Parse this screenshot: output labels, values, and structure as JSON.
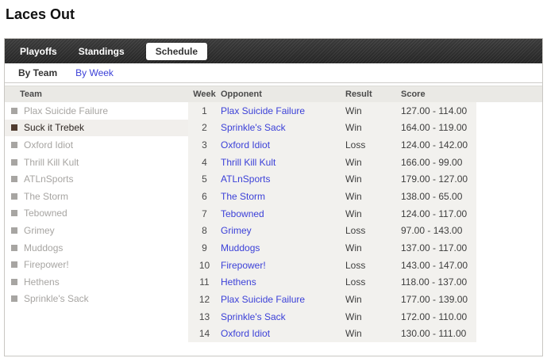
{
  "page": {
    "title": "Laces Out"
  },
  "colors": {
    "link_blue": "#3c41d8",
    "tabbar_dark": "#343434",
    "header_band": "#eae9e5",
    "table_block_bg": "#f2f1ee",
    "selected_bullet": "#503c30",
    "muted_team_text": "#a7a5a2"
  },
  "tabs": [
    {
      "label": "Playoffs",
      "active": false
    },
    {
      "label": "Standings",
      "active": false
    },
    {
      "label": "Schedule",
      "active": true
    }
  ],
  "subnav": [
    {
      "label": "By Team",
      "active": true
    },
    {
      "label": "By Week",
      "active": false
    }
  ],
  "sidebar": {
    "header": "Team",
    "teams": [
      {
        "name": "Plax Suicide Failure",
        "selected": false
      },
      {
        "name": "Suck it Trebek",
        "selected": true
      },
      {
        "name": "Oxford Idiot",
        "selected": false
      },
      {
        "name": "Thrill Kill Kult",
        "selected": false
      },
      {
        "name": "ATLnSports",
        "selected": false
      },
      {
        "name": "The Storm",
        "selected": false
      },
      {
        "name": "Tebowned",
        "selected": false
      },
      {
        "name": "Grimey",
        "selected": false
      },
      {
        "name": "Muddogs",
        "selected": false
      },
      {
        "name": "Firepower!",
        "selected": false
      },
      {
        "name": "Hethens",
        "selected": false
      },
      {
        "name": "Sprinkle's Sack",
        "selected": false
      }
    ]
  },
  "table": {
    "headers": {
      "week": "Week",
      "opponent": "Opponent",
      "result": "Result",
      "score": "Score"
    },
    "rows": [
      {
        "week": "1",
        "opponent": "Plax Suicide Failure",
        "result": "Win",
        "score": "127.00 - 114.00"
      },
      {
        "week": "2",
        "opponent": "Sprinkle's Sack",
        "result": "Win",
        "score": "164.00 - 119.00"
      },
      {
        "week": "3",
        "opponent": "Oxford Idiot",
        "result": "Loss",
        "score": "124.00 - 142.00"
      },
      {
        "week": "4",
        "opponent": "Thrill Kill Kult",
        "result": "Win",
        "score": "166.00 - 99.00"
      },
      {
        "week": "5",
        "opponent": "ATLnSports",
        "result": "Win",
        "score": "179.00 - 127.00"
      },
      {
        "week": "6",
        "opponent": "The Storm",
        "result": "Win",
        "score": "138.00 - 65.00"
      },
      {
        "week": "7",
        "opponent": "Tebowned",
        "result": "Win",
        "score": "124.00 - 117.00"
      },
      {
        "week": "8",
        "opponent": "Grimey",
        "result": "Loss",
        "score": "97.00 - 143.00"
      },
      {
        "week": "9",
        "opponent": "Muddogs",
        "result": "Win",
        "score": "137.00 - 117.00"
      },
      {
        "week": "10",
        "opponent": "Firepower!",
        "result": "Loss",
        "score": "143.00 - 147.00"
      },
      {
        "week": "11",
        "opponent": "Hethens",
        "result": "Loss",
        "score": "118.00 - 137.00"
      },
      {
        "week": "12",
        "opponent": "Plax Suicide Failure",
        "result": "Win",
        "score": "177.00 - 139.00"
      },
      {
        "week": "13",
        "opponent": "Sprinkle's Sack",
        "result": "Win",
        "score": "172.00 - 110.00"
      },
      {
        "week": "14",
        "opponent": "Oxford Idiot",
        "result": "Win",
        "score": "130.00 - 111.00"
      }
    ]
  }
}
